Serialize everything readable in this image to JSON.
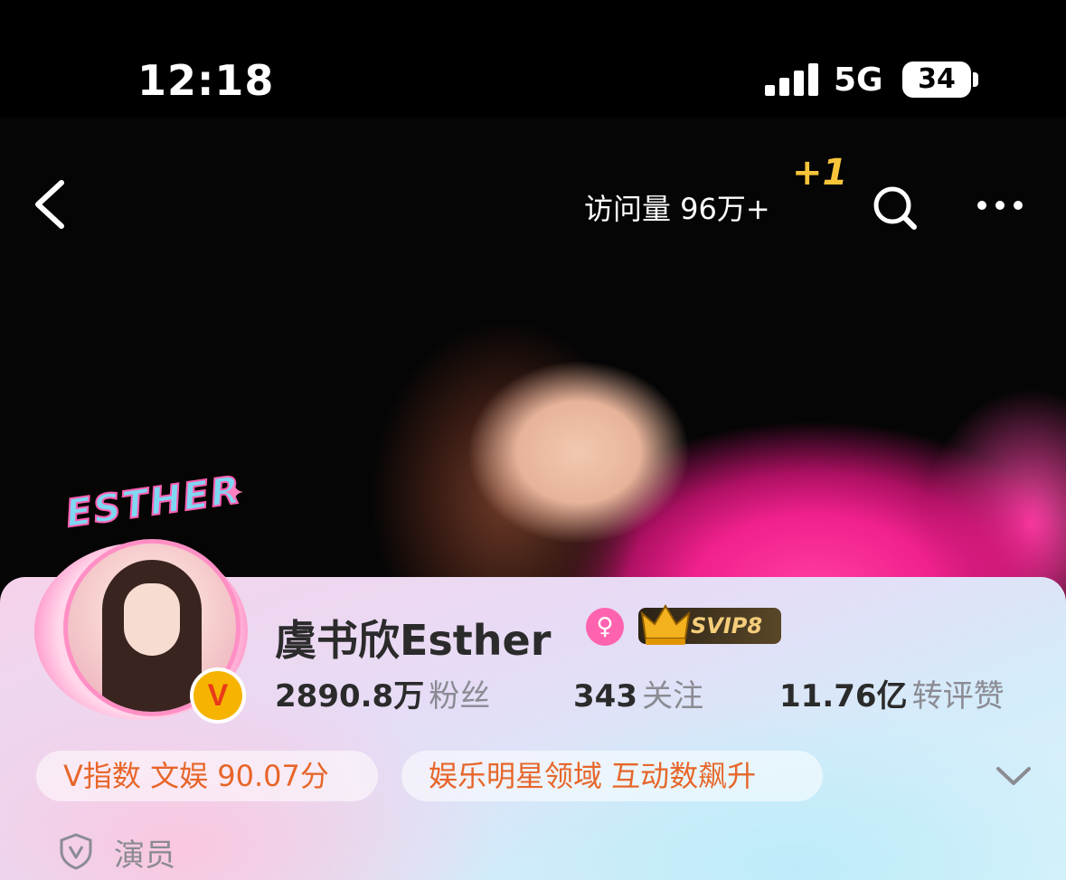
{
  "status_bar": {
    "time": "12:18",
    "network": "5G",
    "battery": "34"
  },
  "nav": {
    "visits": "访问量 96万+",
    "visits_increment": "+1"
  },
  "profile": {
    "avatar_badge_text": "ESTHER",
    "verified_badge": "V",
    "name": "虞书欣Esther",
    "gender_icon": "female-icon",
    "vip_label": "SVIP8",
    "stats": [
      {
        "value": "2890.8万",
        "label": "粉丝"
      },
      {
        "value": "343",
        "label": "关注"
      },
      {
        "value": "11.76亿",
        "label": "转评赞"
      }
    ],
    "tags": [
      "V指数 文娱 90.07分",
      "娱乐明星领域 互动数飙升"
    ],
    "role": "演员"
  },
  "colors": {
    "accent_orange": "#e7662a",
    "vip_gold": "#f5cd7a",
    "pink": "#ff63b0"
  }
}
